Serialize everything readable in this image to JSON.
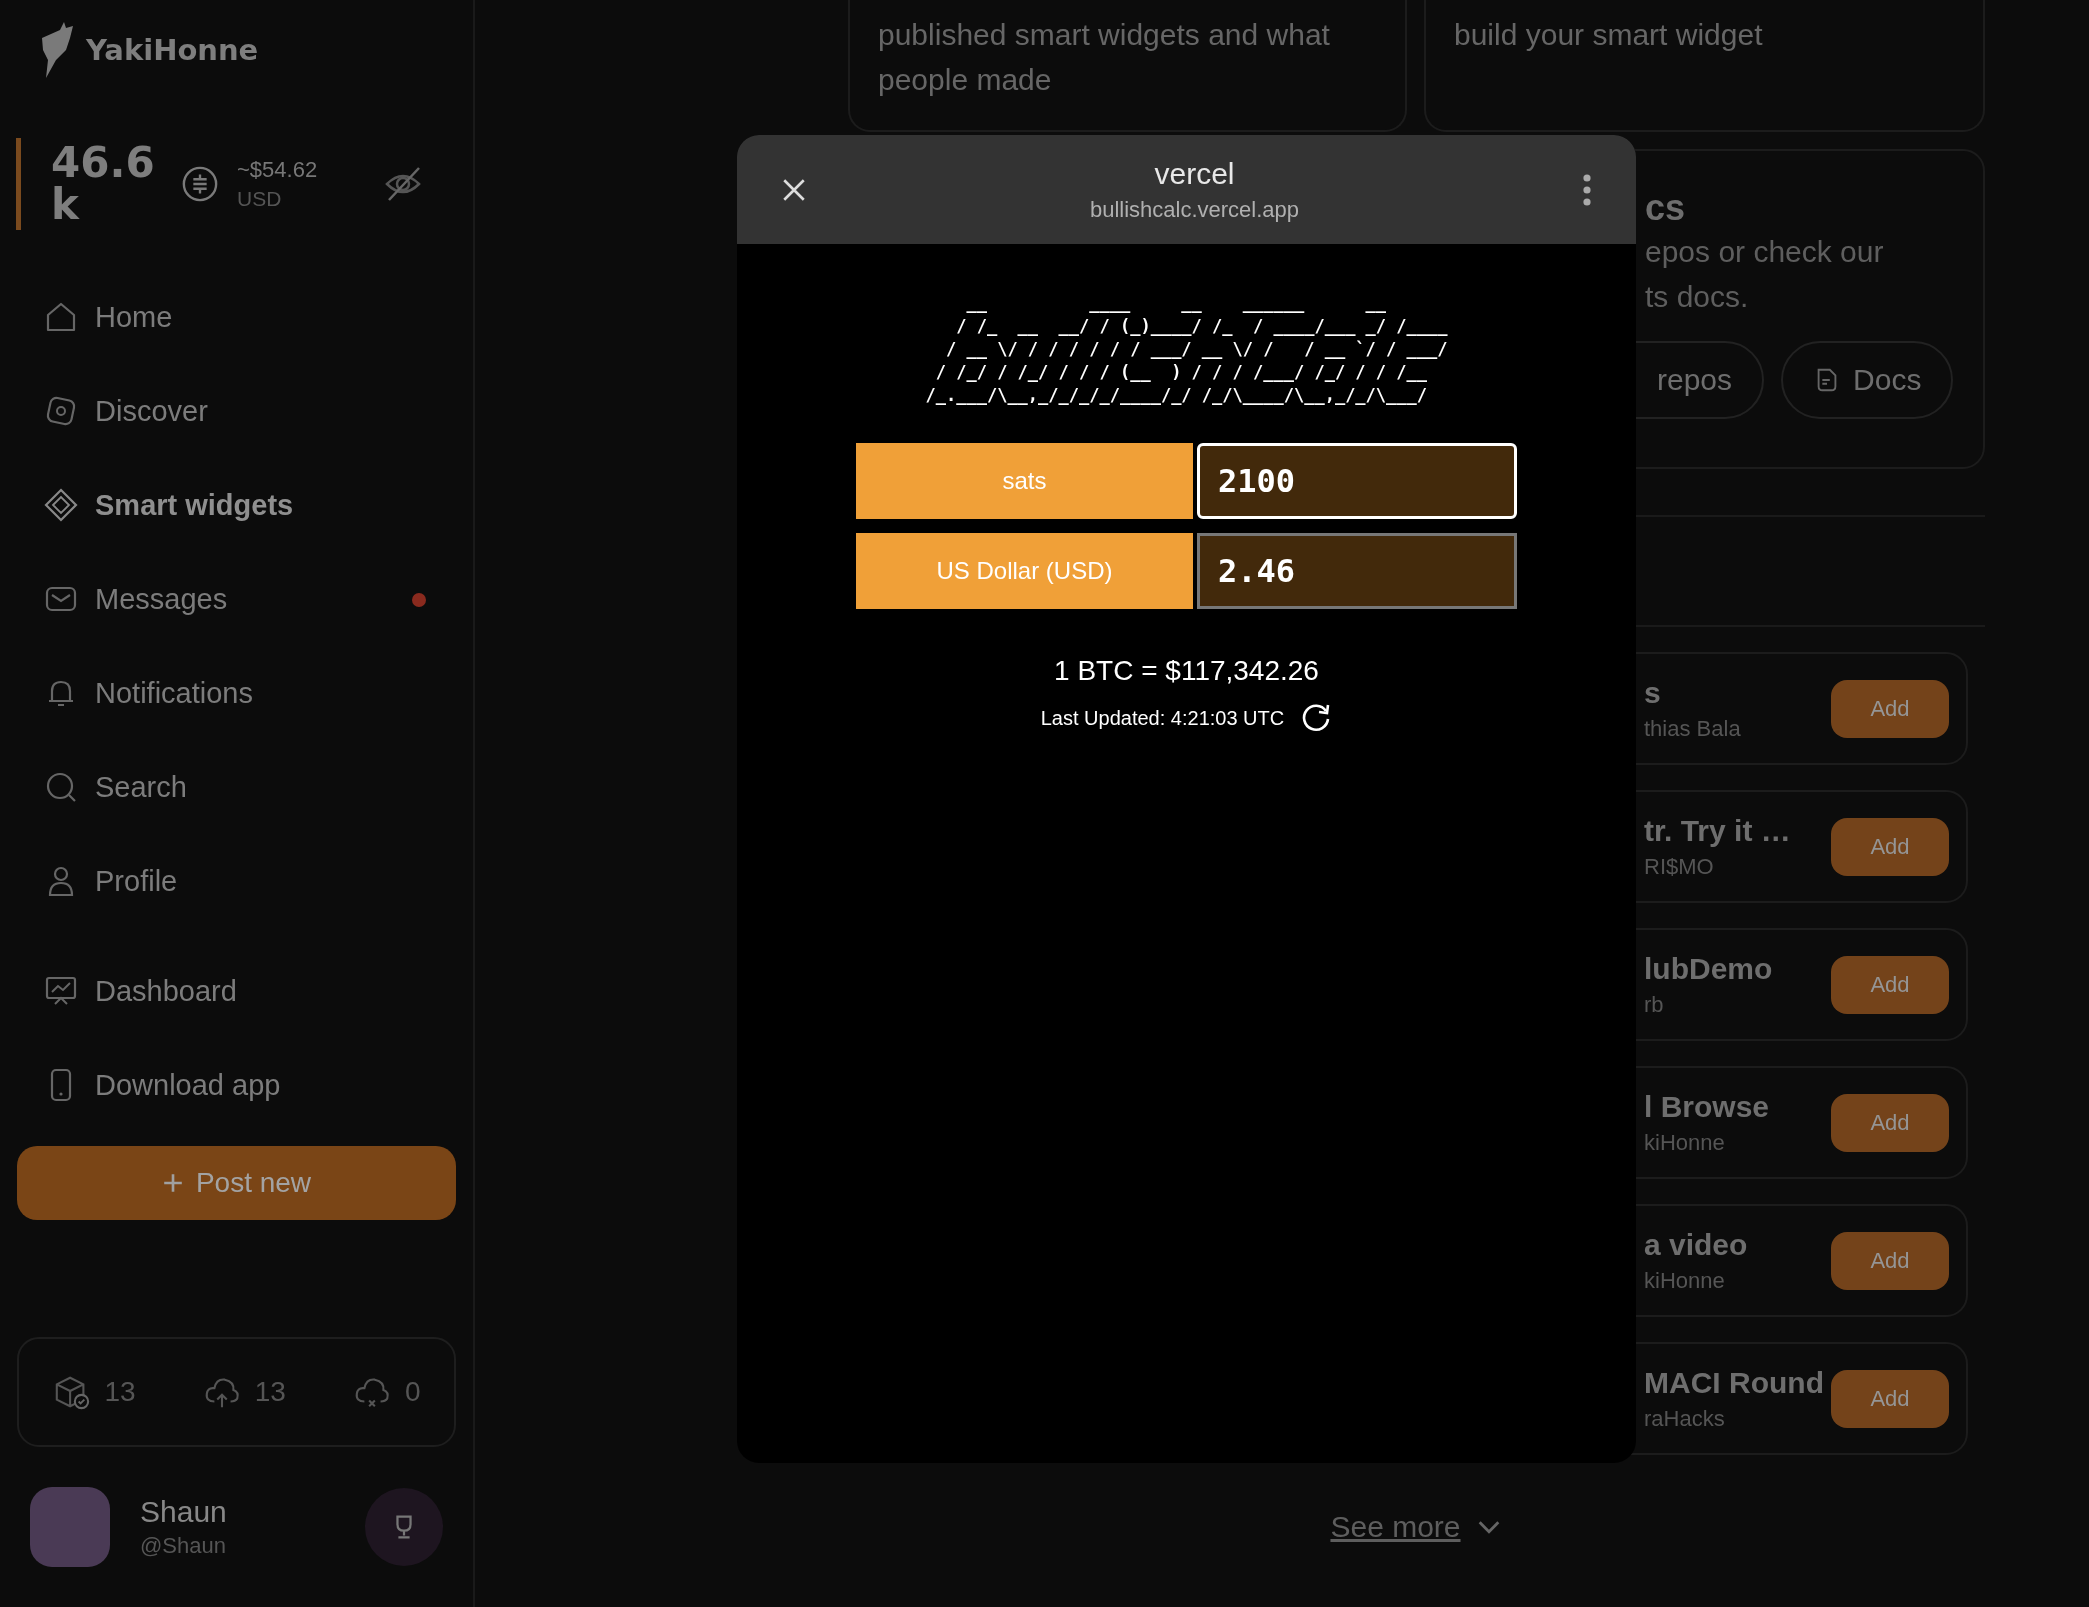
{
  "sidebar": {
    "logo_text": "YakiHonne",
    "balance": {
      "amount": "46.6 k",
      "fiat": "~$54.62",
      "currency": "USD"
    },
    "nav": [
      {
        "label": "Home",
        "selected": false,
        "unread": false
      },
      {
        "label": "Discover",
        "selected": false,
        "unread": false
      },
      {
        "label": "Smart widgets",
        "selected": true,
        "unread": false
      },
      {
        "label": "Messages",
        "selected": false,
        "unread": true
      },
      {
        "label": "Notifications",
        "selected": false,
        "unread": false
      },
      {
        "label": "Search",
        "selected": false,
        "unread": false
      },
      {
        "label": "Profile",
        "selected": false,
        "unread": false
      }
    ],
    "nav_secondary": [
      {
        "label": "Dashboard",
        "selected": false
      },
      {
        "label": "Download app",
        "selected": false
      }
    ],
    "post_button": "Post new",
    "stats": [
      {
        "kind": "published",
        "value": "13"
      },
      {
        "kind": "uploaded",
        "value": "13"
      },
      {
        "kind": "failed",
        "value": "0"
      }
    ],
    "user": {
      "name": "Shaun",
      "handle": "@Shaun"
    }
  },
  "main": {
    "top_cards": [
      {
        "lines": [
          "published smart widgets and what",
          "people made"
        ]
      },
      {
        "lines": [
          "build your smart widget"
        ]
      }
    ],
    "docs_card": {
      "title": "cs",
      "lines": [
        "epos or check our",
        "ts docs."
      ],
      "buttons": [
        "repos",
        "Docs"
      ]
    },
    "widgets": [
      {
        "title": "s",
        "author": "thias Bala",
        "action": "Add"
      },
      {
        "title": "tr. Try it …",
        "author": "RI$MO",
        "action": "Add"
      },
      {
        "title": "lubDemo",
        "author": "rb",
        "action": "Add"
      },
      {
        "title": "l Browse",
        "author": "kiHonne",
        "action": "Add"
      },
      {
        "title": "a video",
        "author": "kiHonne",
        "action": "Add"
      },
      {
        "title": "MACI Round",
        "author": "raHacks",
        "action": "Add"
      }
    ],
    "see_more": "See more"
  },
  "modal": {
    "title": "vercel",
    "url": "bullishcalc.vercel.app",
    "ascii_banner": [
      "    __          ____     __    ______      __",
      "   / /_  __  __/ / (_)____/ /_  / ____/___ _/ /____",
      "  / __ \\/ / / / / / / ___/ __ \\/ /   / __ `/ / ___/",
      " / /_/ / /_/ / / / (__  ) / / / /___/ /_/ / / /__",
      "/_.___/\\__,_/_/_/_/____/_/ /_/\\____/\\__,_/_/\\___/"
    ],
    "converter": [
      {
        "unit": "sats",
        "value": "2100",
        "focused": true
      },
      {
        "unit": "US Dollar (USD)",
        "value": "2.46",
        "focused": false
      }
    ],
    "rate": "1 BTC = $117,342.26",
    "last_updated": "Last Updated: 4:21:03 UTC"
  }
}
